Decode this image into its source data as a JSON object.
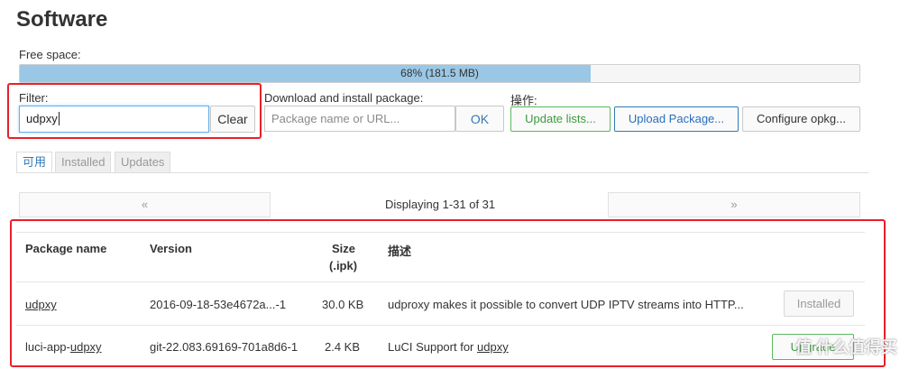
{
  "page": {
    "title": "Software"
  },
  "free_space": {
    "label": "Free space:",
    "text": "68% (181.5 MB)",
    "fraction": 0.68
  },
  "filter": {
    "label": "Filter:",
    "value": "udpxy",
    "clear_label": "Clear"
  },
  "download": {
    "label": "Download and install package:",
    "placeholder": "Package name or URL...",
    "ok_label": "OK"
  },
  "actions": {
    "label": "操作:",
    "update_lists": "Update lists...",
    "upload_package": "Upload Package...",
    "configure_opkg": "Configure opkg..."
  },
  "tabs": [
    {
      "label": "可用",
      "active": true
    },
    {
      "label": "Installed",
      "active": false
    },
    {
      "label": "Updates",
      "active": false
    }
  ],
  "pager": {
    "prev": "«",
    "status": "Displaying 1-31 of 31",
    "next": "»"
  },
  "table": {
    "headers": {
      "name": "Package name",
      "version": "Version",
      "size_line1": "Size",
      "size_line2": "(.ipk)",
      "description": "描述"
    },
    "rows": [
      {
        "name": "udpxy",
        "version": "2016-09-18-53e4672a...-1",
        "size": "30.0 KB",
        "description": "udproxy makes it possible to convert UDP IPTV streams into HTTP...",
        "action": "Installed"
      },
      {
        "name_prefix": "luci-app-",
        "name_link": "udpxy",
        "version": "git-22.083.69169-701a8d6-1",
        "size": "2.4 KB",
        "description_prefix": "LuCI Support for ",
        "description_link": "udpxy",
        "action": "Upgrade"
      }
    ]
  },
  "watermark": "值 什么值得买",
  "colors": {
    "progress_fill": "#9ac7e5",
    "highlight_box": "#e8202a",
    "accent_blue": "#337ab7",
    "accent_green": "#5cb85c"
  }
}
